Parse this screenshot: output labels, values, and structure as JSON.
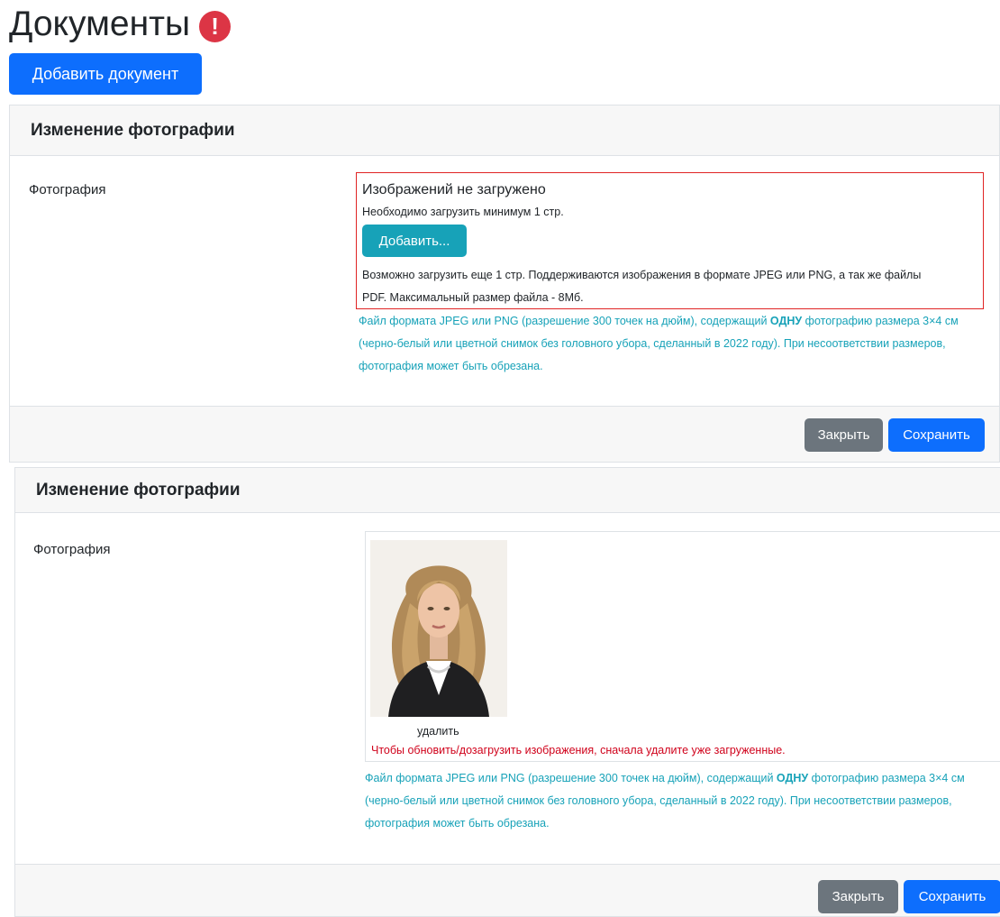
{
  "page": {
    "title": "Документы",
    "alert_badge": "!",
    "add_document_label": "Добавить документ"
  },
  "colors": {
    "primary": "#0d6efd",
    "secondary": "#6c757d",
    "info": "#17a2b8",
    "danger": "#dc3545",
    "error_border": "#e02424"
  },
  "card_empty": {
    "header": "Изменение фотографии",
    "field_label": "Фотография",
    "upload": {
      "title": "Изображений не загружено",
      "min_note": "Необходимо загрузить минимум 1 стр.",
      "add_button": "Добавить...",
      "info_line1": "Возможно загрузить еще 1 стр. Поддерживаются изображения в формате JPEG или PNG, а так же файлы",
      "info_line2": "PDF. Максимальный размер файла - 8Мб."
    },
    "hint": {
      "before": "Файл формата JPEG или PNG (разрешение 300 точек на дюйм), содержащий ",
      "bold": "ОДНУ",
      "after": " фотографию размера 3×4 см (черно-белый или цветной снимок без головного убора, сделанный в 2022 году). При несоответствии размеров, фотография может быть обрезана."
    },
    "footer": {
      "close_label": "Закрыть",
      "save_label": "Сохранить"
    }
  },
  "card_uploaded": {
    "header": "Изменение фотографии",
    "field_label": "Фотография",
    "image": {
      "delete_label": "удалить",
      "warning": "Чтобы обновить/дозагрузить изображения, сначала удалите уже загруженные."
    },
    "hint": {
      "before": "Файл формата JPEG или PNG (разрешение 300 точек на дюйм), содержащий ",
      "bold": "ОДНУ",
      "after": " фотографию размера 3×4 см (черно-белый или цветной снимок без головного убора, сделанный в 2022 году). При несоответствии размеров, фотография может быть обрезана."
    },
    "footer": {
      "close_label": "Закрыть",
      "save_label": "Сохранить"
    }
  }
}
